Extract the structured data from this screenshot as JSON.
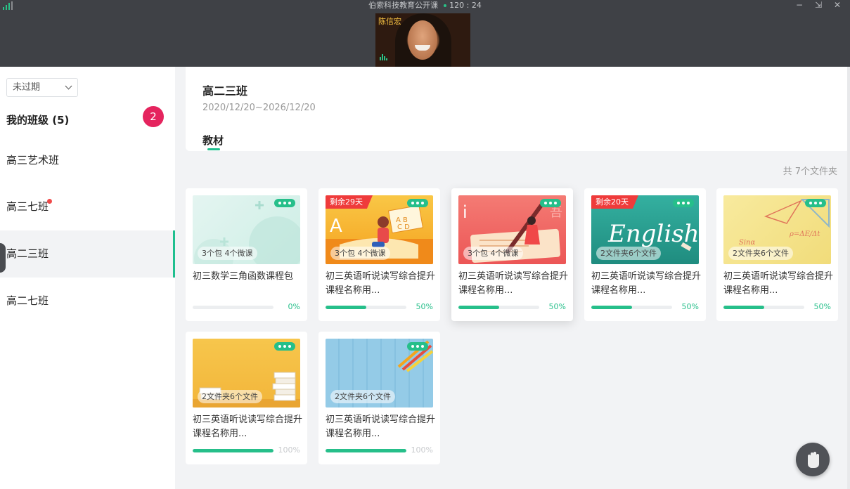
{
  "window": {
    "title": "伯索科技教育公开课",
    "timer": "120 : 24",
    "controls": [
      "−",
      "⇲",
      "✕"
    ],
    "video": {
      "participant_name": "陈信宏"
    }
  },
  "sidebar": {
    "filter": {
      "selected": "未过期"
    },
    "section_title": "我的班级 (5)",
    "badge": "2",
    "classes": [
      {
        "label": "高三艺术班",
        "active": false,
        "unread": false
      },
      {
        "label": "高三七班",
        "active": false,
        "unread": true
      },
      {
        "label": "高二三班",
        "active": true,
        "unread": false
      },
      {
        "label": "高二七班",
        "active": false,
        "unread": false
      }
    ]
  },
  "class_panel": {
    "name": "高二三班",
    "dates": "2020/12/20~2026/12/20",
    "tab": "教材"
  },
  "folder_count": "共 7个文件夹",
  "cards": [
    {
      "thumb_label": "3个包 4个微课",
      "title": "初三数学三角函数课程包",
      "progress_label": "0%",
      "progress": 0,
      "ribbon": "",
      "theme": "math",
      "color": "#d7efe9"
    },
    {
      "thumb_label": "3个包 4个微课",
      "title": "初三英语听说读写综合提升课程名称用...",
      "progress_label": "50%",
      "progress": 50,
      "ribbon": "剩余29天",
      "theme": "abc",
      "color": "#f7b731"
    },
    {
      "thumb_label": "3个包 4个微课",
      "title": "初三英语听说读写综合提升课程名称用...",
      "progress_label": "50%",
      "progress": 50,
      "ribbon": "",
      "theme": "writing",
      "color": "#f16b6b"
    },
    {
      "thumb_label": "2文件夹6个文件",
      "title": "初三英语听说读写综合提升课程名称用...",
      "progress_label": "50%",
      "progress": 50,
      "ribbon": "剩余20天",
      "theme": "english",
      "color": "#2ea495"
    },
    {
      "thumb_label": "2文件夹6个文件",
      "title": "初三英语听说读写综合提升课程名称用...",
      "progress_label": "50%",
      "progress": 50,
      "ribbon": "",
      "theme": "formula",
      "color": "#f5e38e"
    },
    {
      "thumb_label": "2文件夹6个文件",
      "title": "初三英语听说读写综合提升课程名称用...",
      "progress_label": "100%",
      "progress": 100,
      "ribbon": "",
      "theme": "books",
      "color": "#f6c445"
    },
    {
      "thumb_label": "2文件夹6个文件",
      "title": "初三英语听说读写综合提升课程名称用...",
      "progress_label": "100%",
      "progress": 100,
      "ribbon": "",
      "theme": "pencils",
      "color": "#8ec9e6"
    }
  ],
  "fab": {
    "icon": "raise-hand-icon"
  }
}
